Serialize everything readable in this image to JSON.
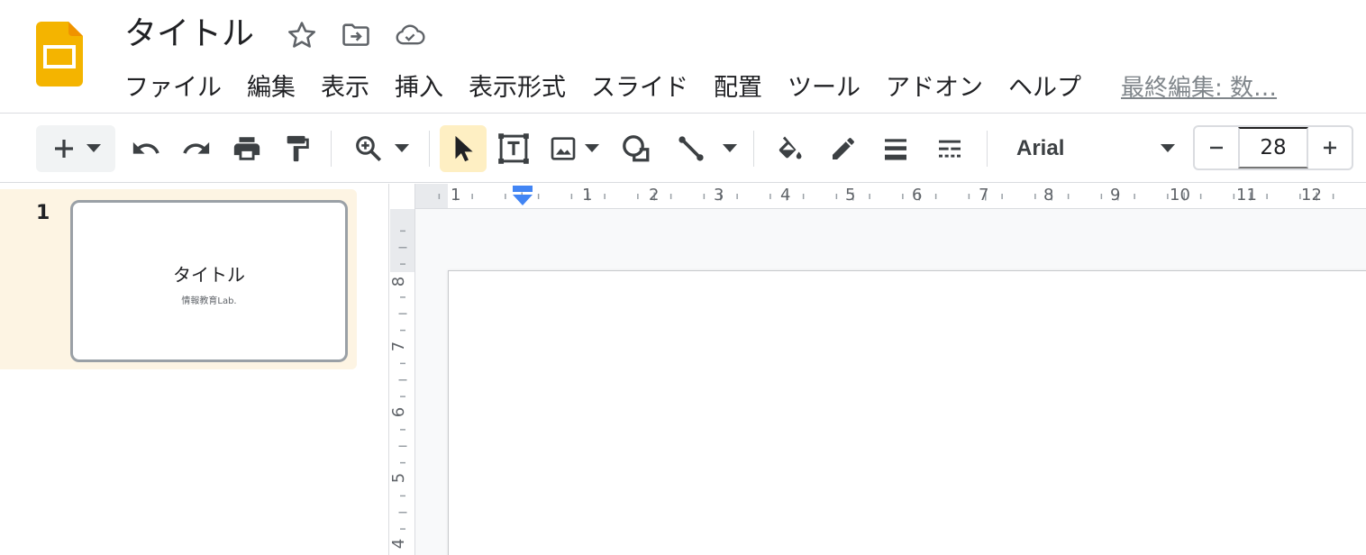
{
  "header": {
    "title": "タイトル",
    "last_edit": "最終編集: 数…",
    "icons": [
      "slides-logo-icon",
      "star-icon",
      "move-to-folder-icon",
      "cloud-saved-icon"
    ]
  },
  "menu": {
    "items": [
      {
        "label": "ファイル"
      },
      {
        "label": "編集"
      },
      {
        "label": "表示"
      },
      {
        "label": "挿入"
      },
      {
        "label": "表示形式"
      },
      {
        "label": "スライド"
      },
      {
        "label": "配置"
      },
      {
        "label": "ツール"
      },
      {
        "label": "アドオン"
      },
      {
        "label": "ヘルプ"
      }
    ]
  },
  "toolbar": {
    "font": "Arial",
    "font_size": "28",
    "active_tool": "select",
    "icons": [
      "new-slide-icon",
      "undo-icon",
      "redo-icon",
      "print-icon",
      "paint-format-icon",
      "zoom-icon",
      "select-icon",
      "text-box-icon",
      "image-icon",
      "shape-icon",
      "line-icon",
      "fill-color-icon",
      "border-color-icon",
      "border-weight-icon",
      "border-dash-icon",
      "decrease-size-icon",
      "increase-size-icon"
    ]
  },
  "filmstrip": {
    "slides": [
      {
        "number": "1",
        "title": "タイトル",
        "subtitle": "情報教育Lab."
      }
    ]
  },
  "ruler": {
    "horizontal": [
      "1",
      "1",
      "2",
      "3",
      "4",
      "5",
      "6",
      "7",
      "8",
      "9",
      "10",
      "11",
      "12"
    ],
    "vertical": [
      "8",
      "7",
      "6",
      "5",
      "4"
    ]
  },
  "colors": {
    "logo": "#f4b400",
    "active_tool_bg": "#feefc3",
    "filmstrip_selected_bg": "#fdf4e3",
    "ruler_marker": "#4285f4"
  }
}
